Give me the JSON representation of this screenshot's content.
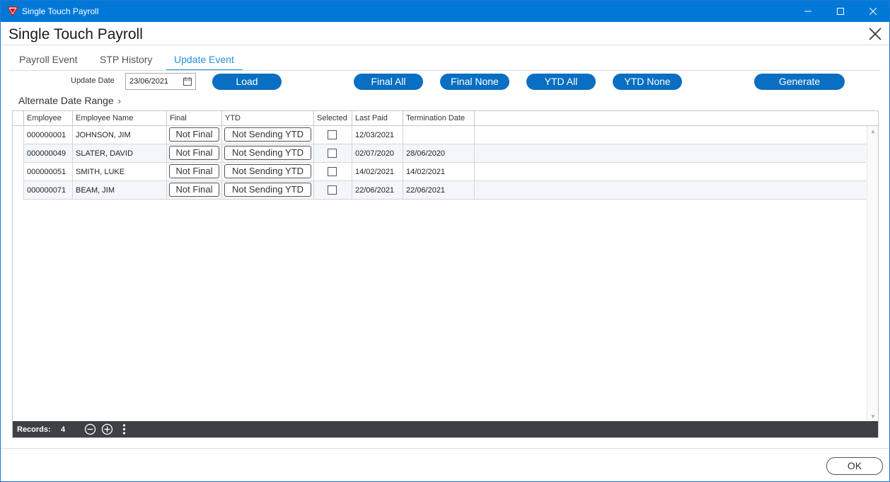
{
  "window": {
    "title": "Single Touch Payroll"
  },
  "header": {
    "title": "Single Touch Payroll"
  },
  "tabs": [
    {
      "label": "Payroll Event",
      "active": false
    },
    {
      "label": "STP History",
      "active": false
    },
    {
      "label": "Update Event",
      "active": true
    }
  ],
  "toolbar": {
    "update_date_label": "Update Date",
    "update_date_value": "23/06/2021",
    "load_label": "Load",
    "final_all_label": "Final All",
    "final_none_label": "Final None",
    "ytd_all_label": "YTD All",
    "ytd_none_label": "YTD None",
    "generate_label": "Generate",
    "alternate_date_range_label": "Alternate Date Range"
  },
  "grid": {
    "columns": [
      "Employee",
      "Employee Name",
      "Final",
      "YTD",
      "Selected",
      "Last Paid",
      "Termination Date"
    ],
    "rows": [
      {
        "employee": "000000001",
        "name": "JOHNSON, JIM",
        "final": "Not Final",
        "ytd": "Not Sending YTD",
        "selected": false,
        "last_paid": "12/03/2021",
        "termination_date": ""
      },
      {
        "employee": "000000049",
        "name": "SLATER, DAVID",
        "final": "Not Final",
        "ytd": "Not Sending YTD",
        "selected": false,
        "last_paid": "02/07/2020",
        "termination_date": "28/06/2020"
      },
      {
        "employee": "000000051",
        "name": "SMITH, LUKE",
        "final": "Not Final",
        "ytd": "Not Sending YTD",
        "selected": false,
        "last_paid": "14/02/2021",
        "termination_date": "14/02/2021"
      },
      {
        "employee": "000000071",
        "name": "BEAM, JIM",
        "final": "Not Final",
        "ytd": "Not Sending YTD",
        "selected": false,
        "last_paid": "22/06/2021",
        "termination_date": "22/06/2021"
      }
    ],
    "footer": {
      "records_label": "Records:",
      "records_count": "4"
    }
  },
  "dialog": {
    "ok_label": "OK"
  },
  "colors": {
    "title_bar": "#0078d7",
    "accent": "#2a8fd4",
    "button": "#0a6fc2",
    "footer_bar": "#3d4044"
  },
  "icons": [
    "app-logo-icon",
    "minimize-icon",
    "maximize-icon",
    "close-icon",
    "calendar-icon",
    "chevron-right-icon",
    "remove-icon",
    "add-icon",
    "more-vertical-icon"
  ]
}
